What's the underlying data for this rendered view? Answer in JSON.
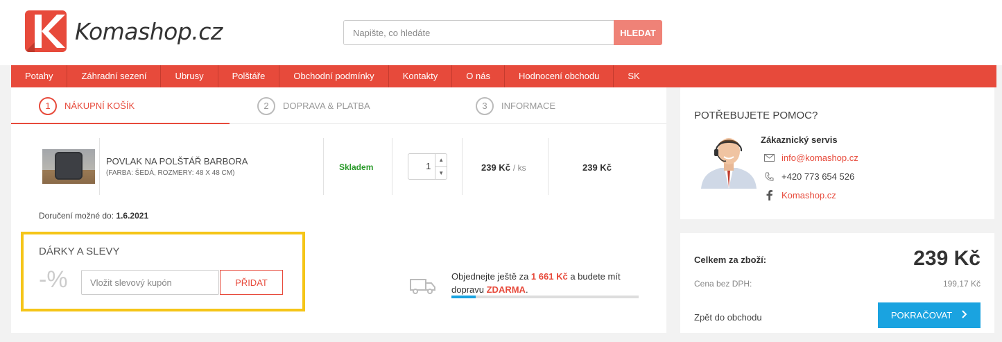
{
  "brand": {
    "name": "Komashop.cz",
    "color": "#e74a3b"
  },
  "search": {
    "placeholder": "Napište, co hledáte",
    "button": "HLEDAT"
  },
  "nav": [
    "Potahy",
    "Záhradní sezení",
    "Ubrusy",
    "Polštáře",
    "Obchodní podmínky",
    "Kontakty",
    "O nás",
    "Hodnocení obchodu",
    "SK"
  ],
  "steps": [
    {
      "num": "1",
      "label": "NÁKUPNÍ KOŠÍK",
      "active": true
    },
    {
      "num": "2",
      "label": "DOPRAVA & PLATBA",
      "active": false
    },
    {
      "num": "3",
      "label": "INFORMACE",
      "active": false
    }
  ],
  "cart": {
    "item": {
      "name": "POVLAK NA POLŠTÁŘ BARBORA",
      "variant": "(FARBA: ŠEDÁ, ROZMERY: 48 X 48 CM)",
      "stock": "Skladem",
      "quantity": "1",
      "unit_price": "239 Kč",
      "unit": "/ ks",
      "total": "239 Kč"
    },
    "delivery_label": "Doručení možné do:",
    "delivery_date": "1.6.2021"
  },
  "gifts": {
    "title": "DÁRKY A SLEVY",
    "percent_icon": "-%",
    "coupon_placeholder": "Vložit slevový kupón",
    "add_button": "PŘIDAT"
  },
  "shipping": {
    "text_before": "Objednejte ještě za",
    "amount": "1 661 Kč",
    "text_middle": "a budete mít dopravu",
    "free": "ZDARMA",
    "text_end": ".",
    "progress": 0.13,
    "icon": "truck-icon"
  },
  "help": {
    "title": "POTŘEBUJETE POMOC?",
    "service_title": "Zákaznický servis",
    "email": "info@komashop.cz",
    "phone": "+420 773 654 526",
    "facebook": "Komashop.cz"
  },
  "summary": {
    "total_label": "Celkem za zboží:",
    "total": "239 Kč",
    "net_label": "Cena bez DPH:",
    "net": "199,17 Kč",
    "back": "Zpět do obchodu",
    "continue": "POKRAČOVAT"
  },
  "colors": {
    "accent": "#e74a3b",
    "primary_button": "#1aa3e0",
    "stock": "#2a9a2a",
    "highlight": "#f5c518"
  }
}
